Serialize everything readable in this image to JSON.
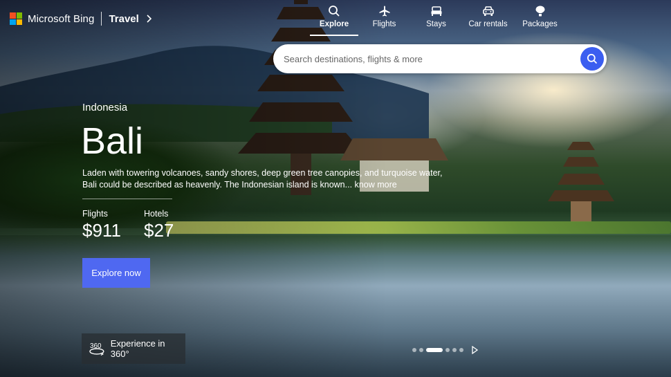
{
  "header": {
    "brand_name": "Microsoft Bing",
    "section": "Travel"
  },
  "nav": {
    "items": [
      {
        "label": "Explore",
        "icon": "search-icon",
        "active": true
      },
      {
        "label": "Flights",
        "icon": "plane-icon",
        "active": false
      },
      {
        "label": "Stays",
        "icon": "bed-icon",
        "active": false
      },
      {
        "label": "Car rentals",
        "icon": "car-icon",
        "active": false
      },
      {
        "label": "Packages",
        "icon": "balloon-icon",
        "active": false
      }
    ]
  },
  "search": {
    "placeholder": "Search destinations, flights & more"
  },
  "destination": {
    "country": "Indonesia",
    "city": "Bali",
    "description": "Laden with towering volcanoes, sandy shores, deep green tree canopies, and turquoise water, Bali could be described as heavenly. The Indonesian island is known...",
    "know_more": "know more"
  },
  "prices": {
    "flights_label": "Flights",
    "flights_value": "$911",
    "hotels_label": "Hotels",
    "hotels_value": "$27"
  },
  "actions": {
    "explore_label": "Explore now",
    "experience_label": "Experience in 360°",
    "experience_icon_text": "360"
  },
  "carousel": {
    "total": 6,
    "active_index": 2
  },
  "colors": {
    "accent": "#4f68f1",
    "search_button": "#3b5ef0",
    "logo": [
      "#f25022",
      "#7fba00",
      "#00a4ef",
      "#ffb900"
    ]
  }
}
